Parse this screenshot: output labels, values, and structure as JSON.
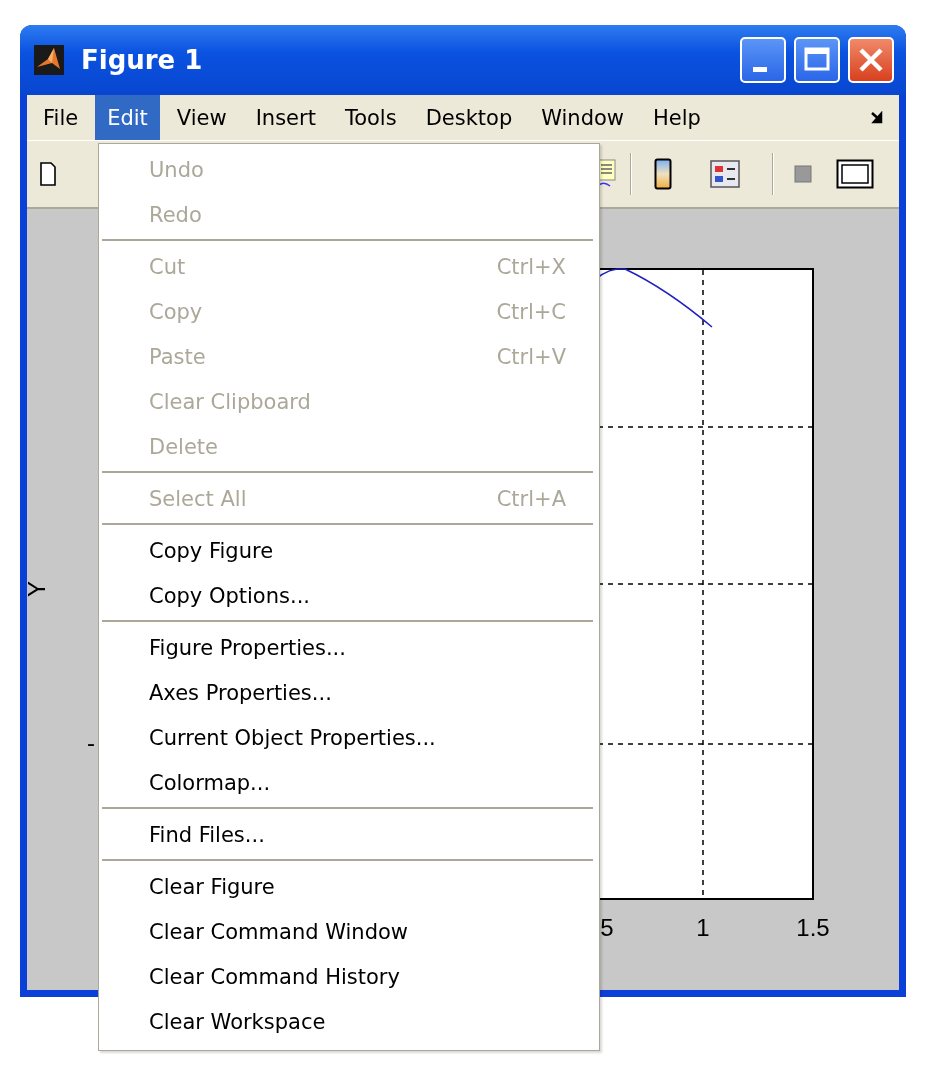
{
  "window": {
    "title": "Figure 1"
  },
  "menubar": [
    {
      "label": "File",
      "selected": false
    },
    {
      "label": "Edit",
      "selected": true
    },
    {
      "label": "View",
      "selected": false
    },
    {
      "label": "Insert",
      "selected": false
    },
    {
      "label": "Tools",
      "selected": false
    },
    {
      "label": "Desktop",
      "selected": false
    },
    {
      "label": "Window",
      "selected": false
    },
    {
      "label": "Help",
      "selected": false
    }
  ],
  "edit_menu": {
    "groups": [
      [
        {
          "label": "Undo",
          "disabled": true
        },
        {
          "label": "Redo",
          "disabled": true
        }
      ],
      [
        {
          "label": "Cut",
          "shortcut": "Ctrl+X",
          "disabled": true
        },
        {
          "label": "Copy",
          "shortcut": "Ctrl+C",
          "disabled": true
        },
        {
          "label": "Paste",
          "shortcut": "Ctrl+V",
          "disabled": true
        },
        {
          "label": "Clear Clipboard",
          "disabled": true
        },
        {
          "label": "Delete",
          "disabled": true
        }
      ],
      [
        {
          "label": "Select All",
          "shortcut": "Ctrl+A",
          "disabled": true
        }
      ],
      [
        {
          "label": "Copy Figure",
          "disabled": false
        },
        {
          "label": "Copy Options...",
          "disabled": false
        }
      ],
      [
        {
          "label": "Figure Properties...",
          "disabled": false
        },
        {
          "label": "Axes Properties...",
          "disabled": false
        },
        {
          "label": "Current Object Properties...",
          "disabled": false
        },
        {
          "label": "Colormap...",
          "disabled": false
        }
      ],
      [
        {
          "label": "Find Files...",
          "disabled": false
        }
      ],
      [
        {
          "label": "Clear Figure",
          "disabled": false
        },
        {
          "label": "Clear Command Window",
          "disabled": false
        },
        {
          "label": "Clear Command History",
          "disabled": false
        },
        {
          "label": "Clear Workspace",
          "disabled": false
        }
      ]
    ]
  },
  "figure": {
    "y_label": "Y",
    "y_tick_labels": [
      "-"
    ],
    "x_tick_labels": [
      "5",
      "1",
      "1.5"
    ]
  }
}
